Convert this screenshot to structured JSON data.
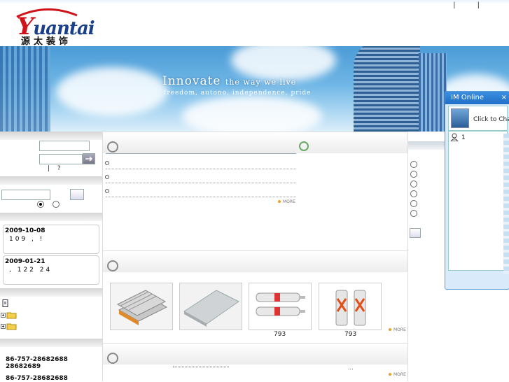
{
  "header": {
    "logo_text": "uantai",
    "logo_y": "Y",
    "logo_cn": "源太装饰",
    "top_links": "| |"
  },
  "banner": {
    "slogan_main": "Innovate",
    "slogan_tail": "the way we live",
    "sub_slogan": "freedom, autono, independence, pride"
  },
  "login": {
    "help_links": "| ?"
  },
  "news": [
    {
      "date": "2009-10-08",
      "text": "109 , !"
    },
    {
      "date": "2009-01-21",
      "text": ", 122 24"
    }
  ],
  "contact": {
    "phone1": "86-757-28682688 28682689",
    "phone2": "86-757-28682688"
  },
  "sections": {
    "more": "MORE"
  },
  "products": [
    {
      "caption": ""
    },
    {
      "caption": ""
    },
    {
      "caption": "793"
    },
    {
      "caption": "793"
    }
  ],
  "bottom_text": "...",
  "im": {
    "title": "IM Online",
    "close": "×",
    "chat_label": "Click to Chat",
    "contact_count": "1"
  },
  "colors": {
    "brand_blue": "#1a3f8a",
    "brand_red": "#d0121b",
    "im_title": "#2a7fd4",
    "accent": "#f0a020"
  }
}
